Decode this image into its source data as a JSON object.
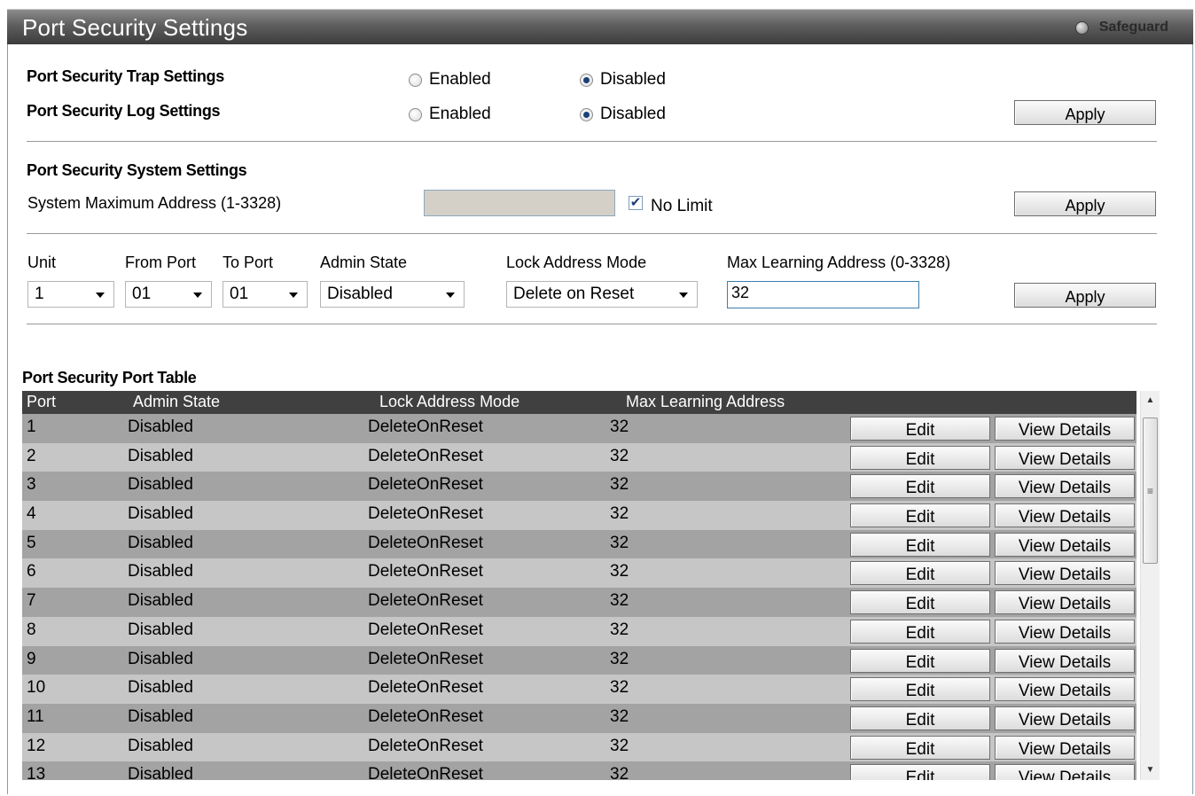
{
  "header": {
    "title": "Port Security Settings",
    "safeguard_label": "Safeguard"
  },
  "trap_settings": {
    "label": "Port Security Trap Settings",
    "enabled_label": "Enabled",
    "disabled_label": "Disabled",
    "selected": "Disabled"
  },
  "log_settings": {
    "label": "Port Security Log Settings",
    "enabled_label": "Enabled",
    "disabled_label": "Disabled",
    "selected": "Disabled"
  },
  "apply_label": "Apply",
  "system_settings": {
    "heading": "Port Security System Settings",
    "max_address_label": "System Maximum Address (1-3328)",
    "max_address_value": "",
    "no_limit_label": "No Limit",
    "no_limit_checked": true
  },
  "port_config": {
    "unit_label": "Unit",
    "unit_value": "1",
    "from_port_label": "From Port",
    "from_port_value": "01",
    "to_port_label": "To Port",
    "to_port_value": "01",
    "admin_state_label": "Admin State",
    "admin_state_value": "Disabled",
    "lock_mode_label": "Lock Address Mode",
    "lock_mode_value": "Delete on Reset",
    "max_learning_label": "Max Learning Address (0-3328)",
    "max_learning_value": "32"
  },
  "table": {
    "title": "Port Security Port Table",
    "columns": [
      "Port",
      "Admin State",
      "Lock Address Mode",
      "Max Learning Address"
    ],
    "edit_label": "Edit",
    "view_label": "View Details",
    "rows": [
      {
        "port": "1",
        "admin": "Disabled",
        "mode": "DeleteOnReset",
        "max": "32"
      },
      {
        "port": "2",
        "admin": "Disabled",
        "mode": "DeleteOnReset",
        "max": "32"
      },
      {
        "port": "3",
        "admin": "Disabled",
        "mode": "DeleteOnReset",
        "max": "32"
      },
      {
        "port": "4",
        "admin": "Disabled",
        "mode": "DeleteOnReset",
        "max": "32"
      },
      {
        "port": "5",
        "admin": "Disabled",
        "mode": "DeleteOnReset",
        "max": "32"
      },
      {
        "port": "6",
        "admin": "Disabled",
        "mode": "DeleteOnReset",
        "max": "32"
      },
      {
        "port": "7",
        "admin": "Disabled",
        "mode": "DeleteOnReset",
        "max": "32"
      },
      {
        "port": "8",
        "admin": "Disabled",
        "mode": "DeleteOnReset",
        "max": "32"
      },
      {
        "port": "9",
        "admin": "Disabled",
        "mode": "DeleteOnReset",
        "max": "32"
      },
      {
        "port": "10",
        "admin": "Disabled",
        "mode": "DeleteOnReset",
        "max": "32"
      },
      {
        "port": "11",
        "admin": "Disabled",
        "mode": "DeleteOnReset",
        "max": "32"
      },
      {
        "port": "12",
        "admin": "Disabled",
        "mode": "DeleteOnReset",
        "max": "32"
      },
      {
        "port": "13",
        "admin": "Disabled",
        "mode": "DeleteOnReset",
        "max": "32"
      }
    ]
  }
}
